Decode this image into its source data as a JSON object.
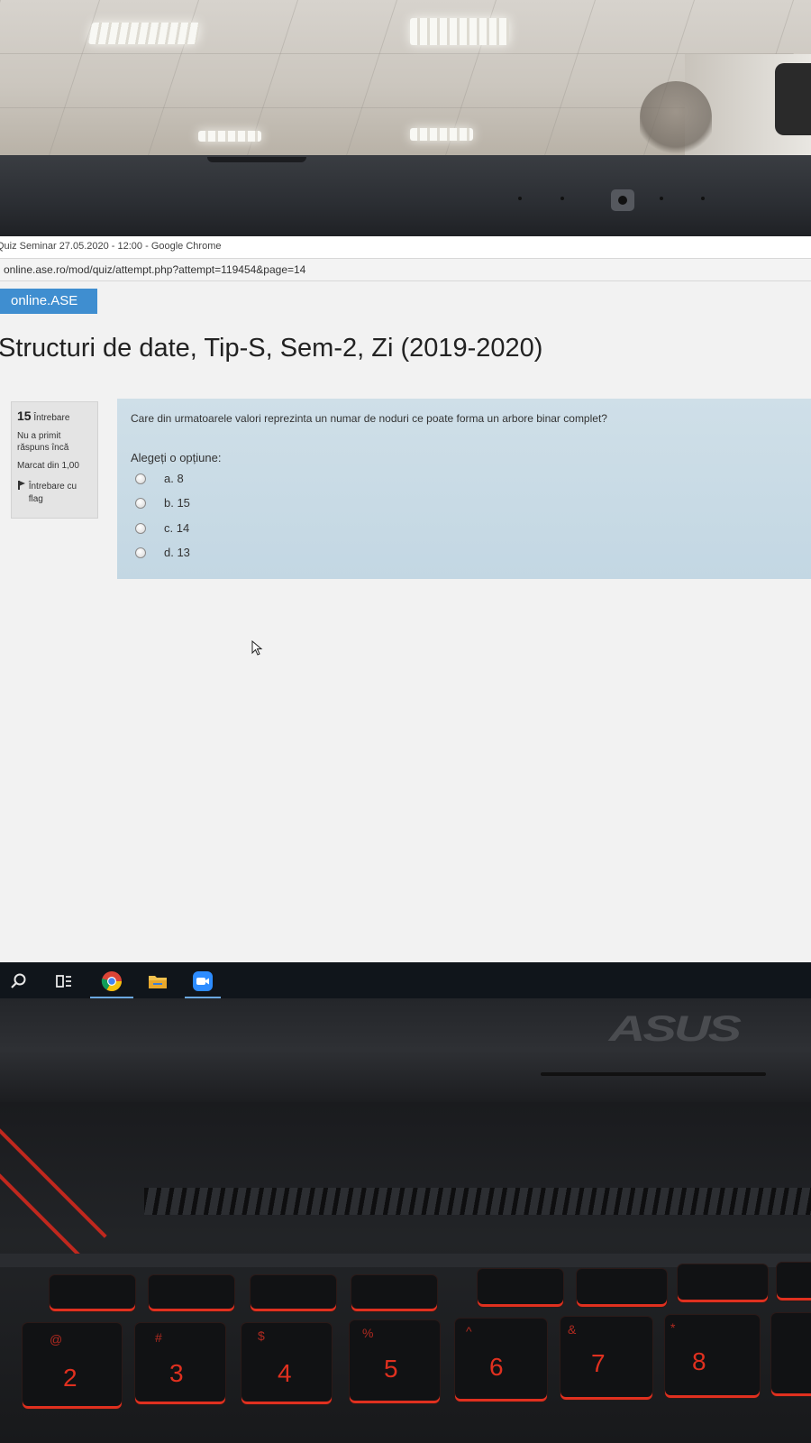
{
  "browser": {
    "window_title": "Quiz Seminar 27.05.2020 - 12:00 - Google Chrome",
    "url": "online.ase.ro/mod/quiz/attempt.php?attempt=119454&page=14"
  },
  "site": {
    "brand": "online.ASE",
    "course_title": "Structuri de date, Tip-S, Sem-2, Zi (2019-2020)"
  },
  "question_info": {
    "number": "15",
    "number_label": "Întrebare",
    "status": "Nu a primit răspuns încă",
    "marked": "Marcat din 1,00",
    "flag_label": "Întrebare cu flag"
  },
  "question": {
    "text": "Care din urmatoarele valori reprezinta un numar de noduri ce poate forma un arbore binar complet?",
    "choose_label": "Alegeți o opțiune:",
    "options": [
      {
        "label": "a. 8",
        "selected": false
      },
      {
        "label": "b. 15",
        "selected": false
      },
      {
        "label": "c. 14",
        "selected": false
      },
      {
        "label": "d. 13",
        "selected": false
      }
    ]
  },
  "taskbar": {
    "icons": [
      "search-icon",
      "task-view-icon",
      "chrome-icon",
      "file-explorer-icon",
      "zoom-icon"
    ]
  },
  "laptop": {
    "logo": "ASUS",
    "keys": [
      {
        "num": "2",
        "sym": "@"
      },
      {
        "num": "3",
        "sym": "#"
      },
      {
        "num": "4",
        "sym": "$"
      },
      {
        "num": "5",
        "sym": "%"
      },
      {
        "num": "6",
        "sym": "^"
      },
      {
        "num": "7",
        "sym": "&"
      },
      {
        "num": "8",
        "sym": "*"
      }
    ]
  },
  "colors": {
    "brand_blue": "#3f8ed0",
    "question_bg": "#c9dbe6",
    "key_accent": "#e0301f"
  }
}
